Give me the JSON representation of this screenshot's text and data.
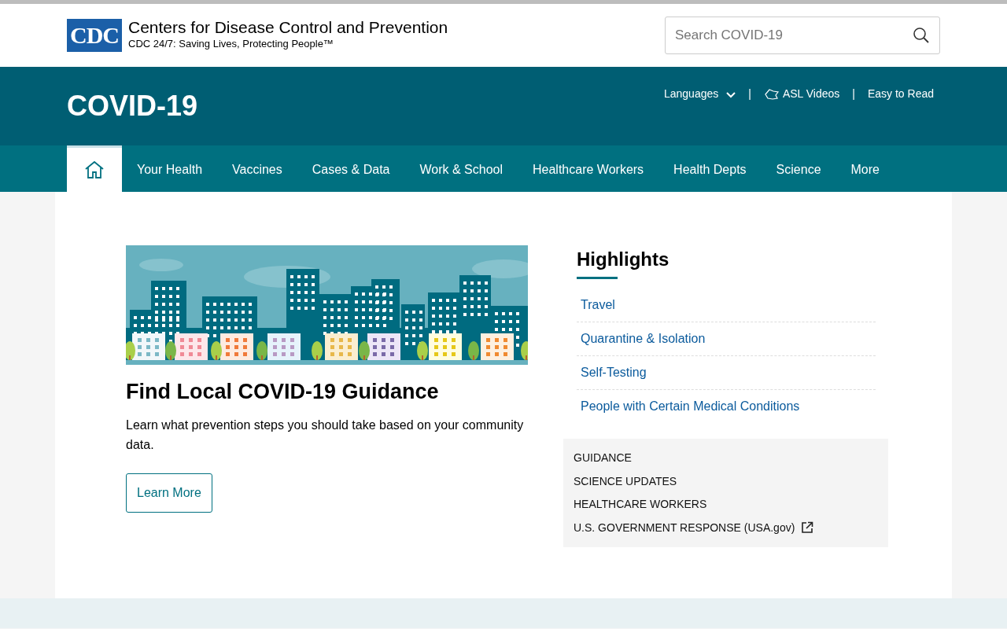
{
  "header": {
    "logo_mark": "CDC",
    "org_name": "Centers for Disease Control and Prevention",
    "tagline": "CDC 24/7: Saving Lives, Protecting People™",
    "search": {
      "placeholder": "Search COVID-19"
    }
  },
  "banner": {
    "title": "COVID-19",
    "links": [
      {
        "kind": "dropdown",
        "label": "Languages"
      },
      {
        "kind": "separator",
        "label": "|"
      },
      {
        "kind": "asl",
        "label": "ASL Videos"
      },
      {
        "kind": "separator",
        "label": "|"
      },
      {
        "kind": "plain",
        "label": "Easy to Read"
      }
    ]
  },
  "nav": {
    "items": [
      {
        "kind": "home",
        "selected": true
      },
      {
        "kind": "link",
        "label": "Your Health",
        "selected": false
      },
      {
        "kind": "link",
        "label": "Vaccines",
        "selected": false
      },
      {
        "kind": "link",
        "label": "Cases & Data",
        "selected": false
      },
      {
        "kind": "link",
        "label": "Work & School",
        "selected": false
      },
      {
        "kind": "link",
        "label": "Healthcare Workers",
        "selected": false
      },
      {
        "kind": "link",
        "label": "Health Depts",
        "selected": false
      },
      {
        "kind": "link",
        "label": "Science",
        "selected": false
      },
      {
        "kind": "link",
        "label": "More",
        "selected": false
      }
    ]
  },
  "feature": {
    "title": "Find Local COVID-19 Guidance",
    "text": "Learn what prevention steps you should take based on your community data.",
    "button": "Learn More"
  },
  "highlights": {
    "title": "Highlights",
    "links": [
      "Travel",
      "Quarantine & Isolation",
      "Self-Testing",
      "People with Certain Medical Conditions"
    ]
  },
  "quick_links": [
    {
      "label": "GUIDANCE",
      "external": false
    },
    {
      "label": "SCIENCE UPDATES",
      "external": false
    },
    {
      "label": "HEALTHCARE WORKERS",
      "external": false
    },
    {
      "label": "U.S. GOVERNMENT RESPONSE (USA.gov)",
      "external": true
    }
  ]
}
